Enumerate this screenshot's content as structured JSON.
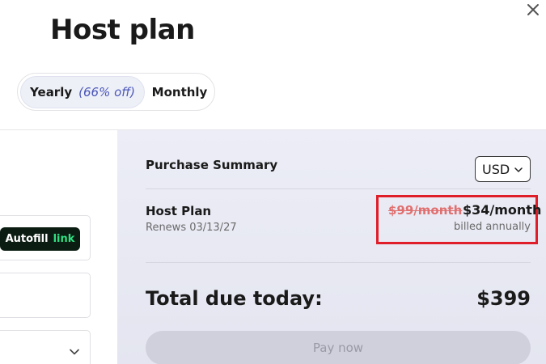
{
  "dialog": {
    "title": "Host plan",
    "close_icon": "close-icon"
  },
  "billing_toggle": {
    "yearly_label": "Yearly",
    "yearly_discount": "(66% off)",
    "monthly_label": "Monthly",
    "selected": "Yearly"
  },
  "form": {
    "autofill_label": "Autofill",
    "autofill_link_label": "link",
    "select_icon": "chevron-down-icon"
  },
  "summary": {
    "title": "Purchase Summary",
    "currency": "USD",
    "plan_name": "Host Plan",
    "renews": "Renews 03/13/27",
    "old_price": "$99/month",
    "new_price": "$34/month",
    "billing_note": "billed annually",
    "total_label": "Total due today:",
    "total_value": "$399",
    "pay_label": "Pay now"
  },
  "colors": {
    "accent_discount": "#4b57b8",
    "highlight_border": "#e01e2a",
    "strike_price": "#e07070",
    "autofill_bg": "#0b1d12",
    "autofill_link": "#2fe082",
    "panel_bg": "#ecedf6"
  }
}
